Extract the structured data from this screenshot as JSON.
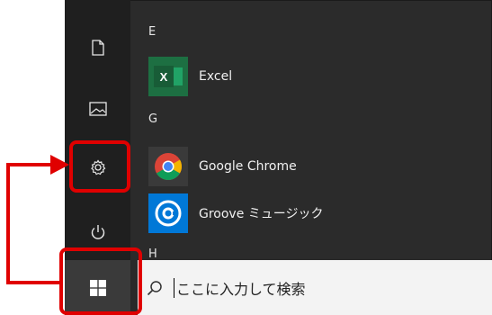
{
  "start_menu": {
    "groups": [
      {
        "letter": "E",
        "apps": [
          {
            "name": "Excel",
            "icon": "excel-icon",
            "color": "#1d6f42"
          }
        ]
      },
      {
        "letter": "G",
        "apps": [
          {
            "name": "Google Chrome",
            "icon": "chrome-icon",
            "color": "#4285f4"
          },
          {
            "name": "Groove ミュージック",
            "icon": "groove-icon",
            "color": "#0078d7"
          }
        ]
      },
      {
        "letter": "H"
      }
    ],
    "rail_icons": [
      "document-icon",
      "pictures-icon",
      "settings-gear-icon",
      "power-icon"
    ]
  },
  "taskbar": {
    "start_icon": "windows-logo-icon",
    "search_icon": "search-icon",
    "search_placeholder": "ここに入力して検索"
  },
  "annotation": {
    "color": "#e00000"
  }
}
